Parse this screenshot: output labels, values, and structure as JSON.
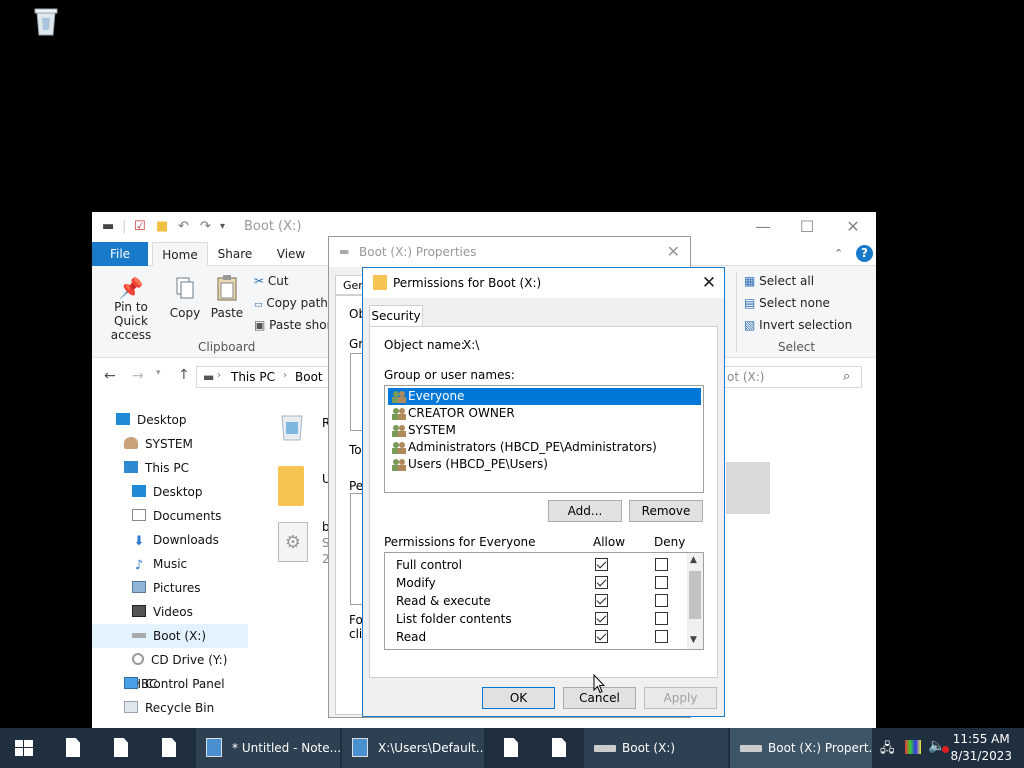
{
  "desktop": {
    "recycle_bin_label": "Recycle Bin"
  },
  "explorer": {
    "title": "Boot (X:)",
    "tabs": {
      "file": "File",
      "home": "Home",
      "share": "Share",
      "view": "View"
    },
    "ribbon": {
      "pin_line1": "Pin to Quick",
      "pin_line2": "access",
      "copy": "Copy",
      "paste": "Paste",
      "cut": "Cut",
      "copy_path": "Copy path",
      "paste_shortcut": "Paste short",
      "clipboard_group": "Clipboard",
      "select_all": "Select all",
      "select_none": "Select none",
      "invert_selection": "Invert selection",
      "select_group": "Select"
    },
    "address": {
      "this_pc": "This PC",
      "boot": "Boot",
      "search_placeholder": "ot (X:)"
    },
    "nav": [
      {
        "label": "Desktop"
      },
      {
        "label": "SYSTEM"
      },
      {
        "label": "This PC"
      },
      {
        "label": "Desktop"
      },
      {
        "label": "Documents"
      },
      {
        "label": "Downloads"
      },
      {
        "label": "Music"
      },
      {
        "label": "Pictures"
      },
      {
        "label": "Videos"
      },
      {
        "label": "Boot (X:)"
      },
      {
        "label": "CD Drive (Y:) HBC"
      },
      {
        "label": "Control Panel"
      },
      {
        "label": "Recycle Bin"
      }
    ],
    "content_fragments": {
      "r": "R",
      "u": "U",
      "b": "b",
      "s": "S",
      "two": "2"
    }
  },
  "properties": {
    "title": "Boot (X:) Properties",
    "tab_gen": "Gen",
    "frag_ob": "Ob",
    "frag_gr": "Gr",
    "frag_to": "To",
    "frag_pe": "Pe",
    "frag_fo": "Fo",
    "frag_cli": "clic"
  },
  "permissions": {
    "title": "Permissions for Boot (X:)",
    "tab": "Security",
    "object_name_label": "Object name:",
    "object_name_value": "X:\\",
    "groups_label": "Group or user names:",
    "groups": [
      {
        "name": "Everyone",
        "selected": true
      },
      {
        "name": "CREATOR OWNER",
        "selected": false
      },
      {
        "name": "SYSTEM",
        "selected": false
      },
      {
        "name": "Administrators (HBCD_PE\\Administrators)",
        "selected": false
      },
      {
        "name": "Users (HBCD_PE\\Users)",
        "selected": false
      }
    ],
    "add_button": "Add...",
    "remove_button": "Remove",
    "perm_for_label": "Permissions for Everyone",
    "allow_header": "Allow",
    "deny_header": "Deny",
    "perms": [
      {
        "name": "Full control",
        "allow": true,
        "deny": false
      },
      {
        "name": "Modify",
        "allow": true,
        "deny": false
      },
      {
        "name": "Read & execute",
        "allow": true,
        "deny": false
      },
      {
        "name": "List folder contents",
        "allow": true,
        "deny": false
      },
      {
        "name": "Read",
        "allow": true,
        "deny": false
      }
    ],
    "ok_button": "OK",
    "cancel_button": "Cancel",
    "apply_button": "Apply"
  },
  "taskbar": {
    "items": [
      {
        "label": "* Untitled - Note..."
      },
      {
        "label": "X:\\Users\\Default..."
      },
      {
        "label": "Boot (X:)"
      },
      {
        "label": "Boot (X:) Propert..."
      }
    ],
    "time": "11:55 AM",
    "date": "8/31/2023"
  },
  "colors": {
    "accent": "#0078d7",
    "ribbon_file": "#1979ca",
    "taskbar": "#202f3f"
  }
}
